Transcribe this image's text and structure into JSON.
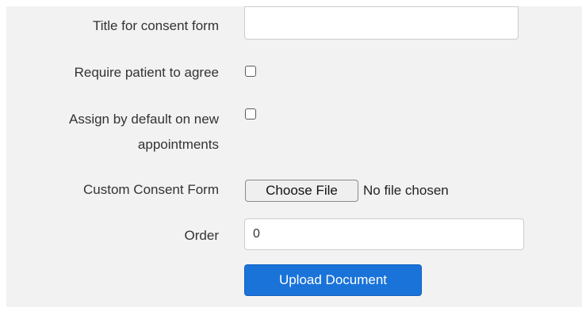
{
  "form": {
    "title_field": {
      "label": "Title for consent form",
      "value": "",
      "placeholder": ""
    },
    "require_agree": {
      "label": "Require patient to agree",
      "checked": false
    },
    "assign_default": {
      "label": "Assign by default on new appointments",
      "checked": false
    },
    "custom_consent_form": {
      "label": "Custom Consent Form",
      "button_label": "Choose File",
      "status": "No file chosen"
    },
    "order": {
      "label": "Order",
      "value": "0"
    },
    "upload_button_label": "Upload Document"
  },
  "colors": {
    "panel_background": "#f2f2f2",
    "primary_button": "#1a73d9",
    "input_border": "#cccccc"
  }
}
